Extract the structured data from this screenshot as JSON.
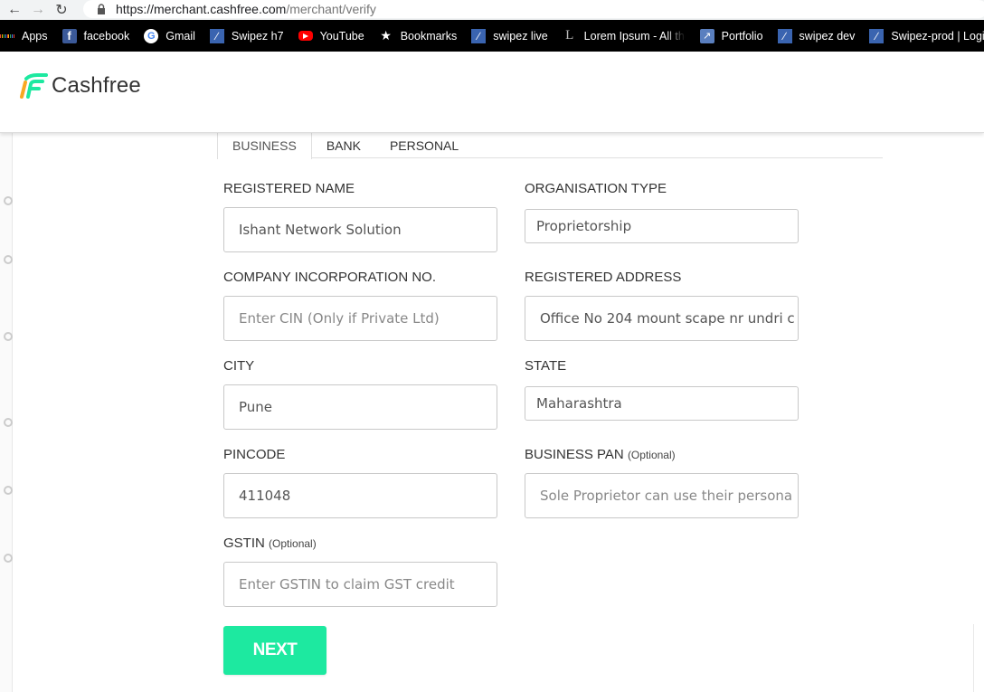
{
  "browser": {
    "url_host": "https://merchant.cashfree.com",
    "url_path": "/merchant/verify",
    "bookmarks": [
      {
        "label": "Apps",
        "icon": "apps-grid-icon"
      },
      {
        "label": "facebook",
        "icon": "facebook-icon"
      },
      {
        "label": "Gmail",
        "icon": "google-icon"
      },
      {
        "label": "Swipez h7",
        "icon": "swipez-icon"
      },
      {
        "label": "YouTube",
        "icon": "youtube-icon"
      },
      {
        "label": "Bookmarks",
        "icon": "star-icon"
      },
      {
        "label": "swipez live",
        "icon": "swipez-icon"
      },
      {
        "label": "Lorem Ipsum - All the",
        "icon": "lorem-icon"
      },
      {
        "label": "Portfolio",
        "icon": "portfolio-icon"
      },
      {
        "label": "swipez dev",
        "icon": "swipez-icon"
      },
      {
        "label": "Swipez-prod | Login",
        "icon": "swipez-icon"
      }
    ]
  },
  "header": {
    "brand": "Cashfree",
    "accent_color": "#1de9a0"
  },
  "tabs": [
    "BUSINESS",
    "BANK",
    "PERSONAL"
  ],
  "form": {
    "registered_name": {
      "label": "REGISTERED NAME",
      "value": "Ishant Network Solution"
    },
    "organisation_type": {
      "label": "ORGANISATION TYPE",
      "value": "Proprietorship"
    },
    "company_incorporation": {
      "label": "COMPANY INCORPORATION NO.",
      "placeholder": "Enter CIN (Only if Private Ltd)"
    },
    "registered_address": {
      "label": "REGISTERED ADDRESS",
      "value": "Office No 204 mount scape nr undri c"
    },
    "city": {
      "label": "CITY",
      "value": "Pune"
    },
    "state": {
      "label": "STATE",
      "value": "Maharashtra"
    },
    "pincode": {
      "label": "PINCODE",
      "value": "411048"
    },
    "business_pan": {
      "label": "BUSINESS PAN",
      "optional": "(Optional)",
      "placeholder": "Sole Proprietor can use their persona"
    },
    "gstin": {
      "label": "GSTIN",
      "optional": "(Optional)",
      "placeholder": "Enter GSTIN to claim GST credit"
    }
  },
  "next_label": "NEXT"
}
